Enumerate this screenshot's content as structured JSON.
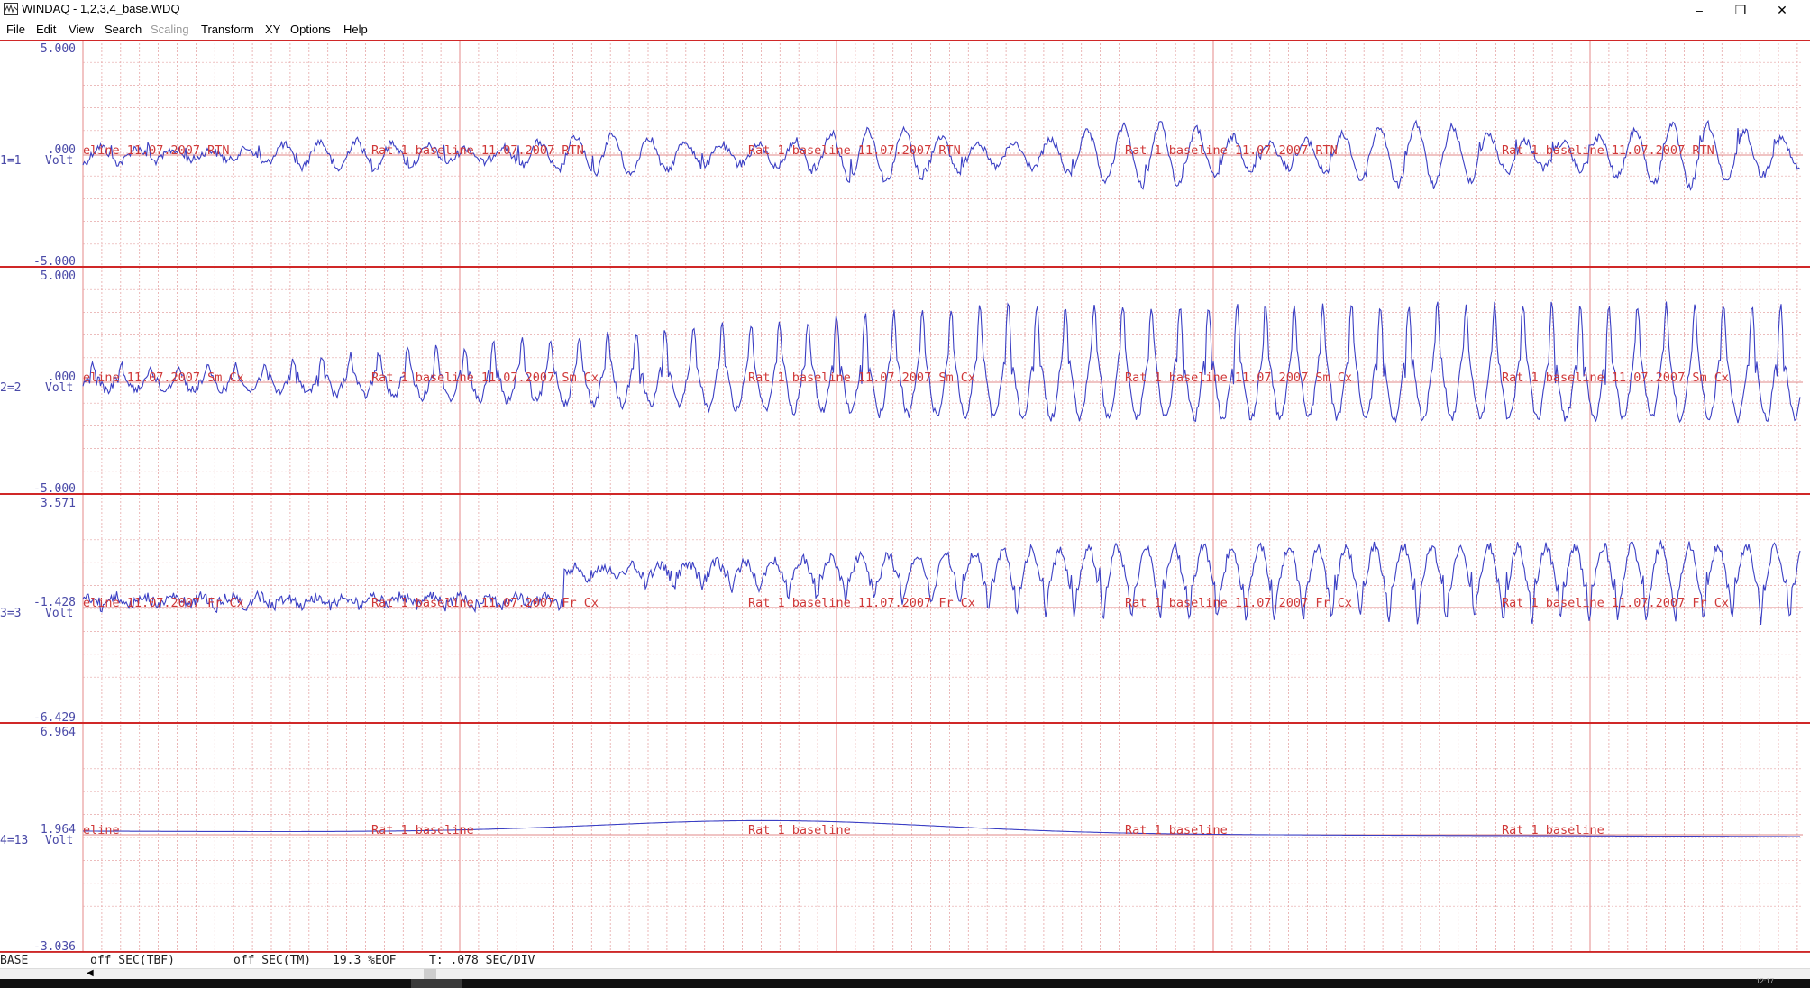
{
  "window": {
    "title": "WINDAQ - 1,2,3,4_base.WDQ",
    "minimize_label": "–",
    "restore_label": "❐",
    "close_label": "✕"
  },
  "menu": {
    "items": [
      {
        "label": "File",
        "enabled": true
      },
      {
        "label": "Edit",
        "enabled": true
      },
      {
        "label": "View",
        "enabled": true
      },
      {
        "label": "Search",
        "enabled": true
      },
      {
        "label": "Scaling",
        "enabled": false
      },
      {
        "label": "Transform",
        "enabled": true
      },
      {
        "label": "XY",
        "enabled": true
      },
      {
        "label": "Options",
        "enabled": true
      },
      {
        "label": "Help",
        "enabled": true
      }
    ]
  },
  "colors": {
    "trace": "#3b3fc4",
    "grid": "#e6a6a6",
    "border": "#d02828",
    "label_text": "#d03838",
    "axis_text": "#4a4aa8"
  },
  "channels": [
    {
      "top_value": "5.000",
      "mid_value": ".000",
      "bottom_value": "-5.000",
      "id": "1=1",
      "unit": "Volt",
      "labels": [
        "eline 11.07.2007 RTN",
        "Rat 1 baseline 11.07.2007 RTN",
        "Rat 1 baseline 11.07.2007 RTN",
        "Rat 1 baseline 11.07.2007 RTN",
        "Rat 1 baseline 11.07.2007 RTN"
      ]
    },
    {
      "top_value": "5.000",
      "mid_value": ".000",
      "bottom_value": "-5.000",
      "id": "2=2",
      "unit": "Volt",
      "labels": [
        "eline 11.07.2007 Sm Cx",
        "Rat 1 baseline 11.07.2007 Sm Cx",
        "Rat 1 baseline 11.07.2007 Sm Cx",
        "Rat 1 baseline 11.07.2007 Sm Cx",
        "Rat 1 baseline 11.07.2007 Sm Cx"
      ]
    },
    {
      "top_value": "3.571",
      "mid_value": "-1.428",
      "bottom_value": "-6.429",
      "id": "3=3",
      "unit": "Volt",
      "labels": [
        "eline 11.07.2007 Fr Cx",
        "Rat 1 baseline 11.07.2007 Fr Cx",
        "Rat 1 baseline 11.07.2007 Fr Cx",
        "Rat 1 baseline 11.07.2007 Fr Cx",
        "Rat 1 baseline 11.07.2007 Fr Cx"
      ]
    },
    {
      "top_value": "6.964",
      "mid_value": "1.964",
      "bottom_value": "-3.036",
      "id": "4=13",
      "unit": "Volt",
      "labels": [
        "eline",
        "Rat 1 baseline",
        "Rat 1 baseline",
        "Rat 1 baseline",
        "Rat 1 baseline"
      ]
    }
  ],
  "status": {
    "base": "BASE",
    "tbf": "off SEC(TBF)",
    "tm": "off SEC(TM)",
    "eof": "19.3 %EOF",
    "t": "T: .078 SEC/DIV"
  },
  "scrollbar": {
    "left_arrow": "◀"
  },
  "taskbar": {
    "clock": "12:17"
  }
}
